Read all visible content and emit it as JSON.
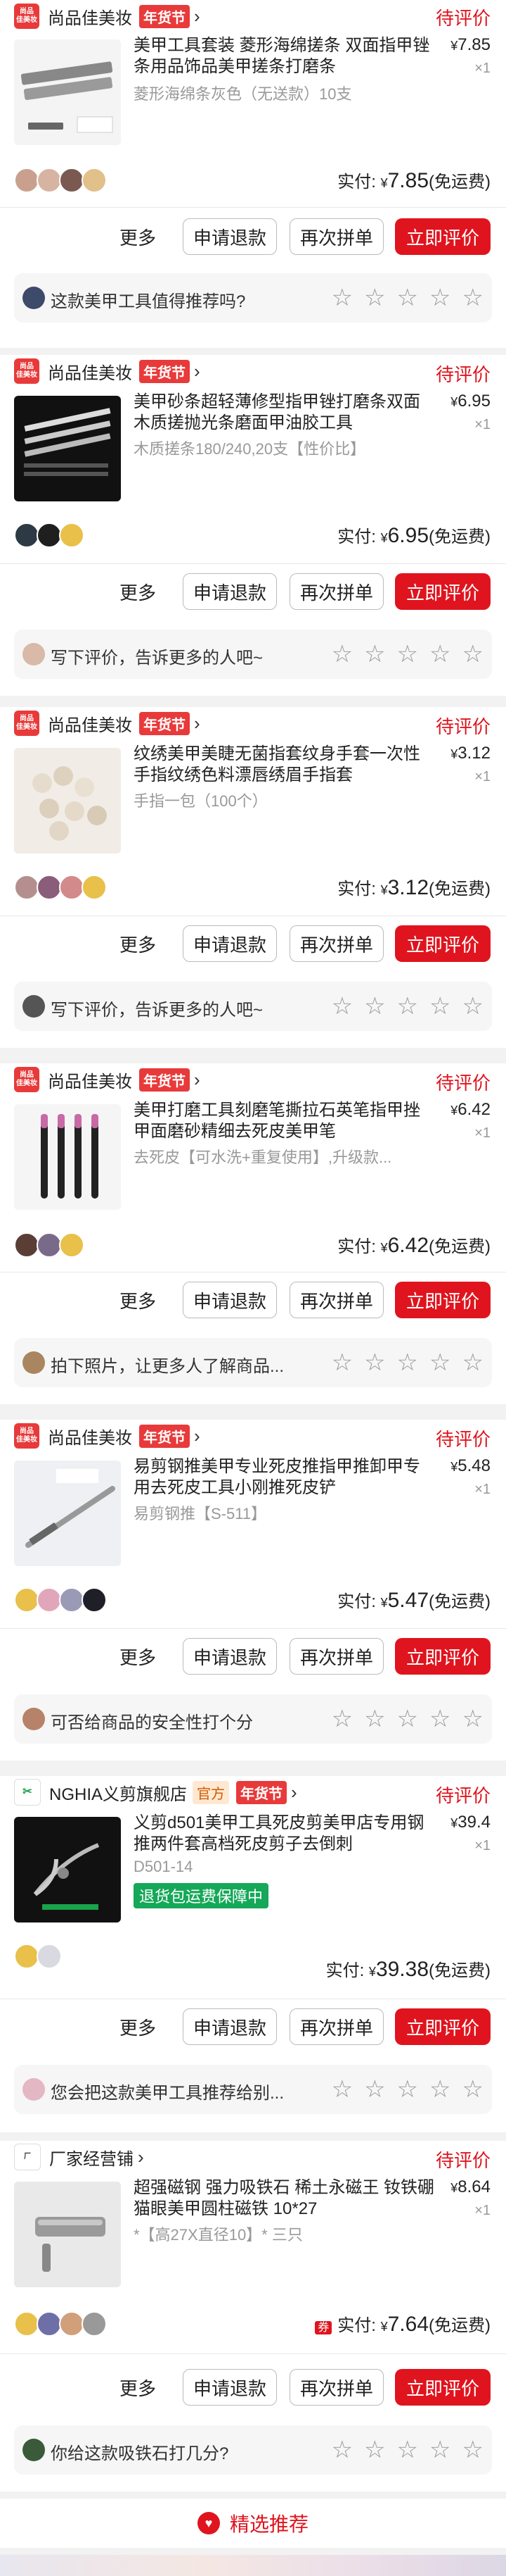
{
  "orders": [
    {
      "shop": {
        "name": "尚品佳美妆",
        "logo": "尚品\n佳美妆",
        "festival_tag": "年货节",
        "official_tag": ""
      },
      "status": "待评价",
      "product": {
        "title": "美甲工具套装 菱形海绵搓条 双面指甲锉条用品饰品美甲搓条打磨条",
        "spec": "菱形海绵条灰色（无送款）10支",
        "price": "7.85",
        "qty": "×1",
        "badge": ""
      },
      "paid": {
        "label": "实付:",
        "currency": "¥",
        "amount": "7.85",
        "note": "(免运费)"
      },
      "actions": {
        "more": "更多",
        "refund": "申请退款",
        "regroup": "再次拼单",
        "review": "立即评价"
      },
      "prompt": "这款美甲工具值得推荐吗?"
    },
    {
      "shop": {
        "name": "尚品佳美妆",
        "logo": "尚品\n佳美妆",
        "festival_tag": "年货节",
        "official_tag": ""
      },
      "status": "待评价",
      "product": {
        "title": "美甲砂条超轻薄修型指甲锉打磨条双面木质搓抛光条磨面甲油胶工具",
        "spec": "木质搓条180/240,20支【性价比】",
        "price": "6.95",
        "qty": "×1",
        "badge": ""
      },
      "paid": {
        "label": "实付:",
        "currency": "¥",
        "amount": "6.95",
        "note": "(免运费)"
      },
      "actions": {
        "more": "更多",
        "refund": "申请退款",
        "regroup": "再次拼单",
        "review": "立即评价"
      },
      "prompt": "写下评价，告诉更多的人吧~"
    },
    {
      "shop": {
        "name": "尚品佳美妆",
        "logo": "尚品\n佳美妆",
        "festival_tag": "年货节",
        "official_tag": ""
      },
      "status": "待评价",
      "product": {
        "title": "纹绣美甲美睫无菌指套纹身手套一次性手指纹绣色料漂唇绣眉手指套",
        "spec": "手指一包（100个）",
        "price": "3.12",
        "qty": "×1",
        "badge": ""
      },
      "paid": {
        "label": "实付:",
        "currency": "¥",
        "amount": "3.12",
        "note": "(免运费)"
      },
      "actions": {
        "more": "更多",
        "refund": "申请退款",
        "regroup": "再次拼单",
        "review": "立即评价"
      },
      "prompt": "写下评价，告诉更多的人吧~"
    },
    {
      "shop": {
        "name": "尚品佳美妆",
        "logo": "尚品\n佳美妆",
        "festival_tag": "年货节",
        "official_tag": ""
      },
      "status": "待评价",
      "product": {
        "title": "美甲打磨工具刻磨笔撕拉石英笔指甲挫甲面磨砂精细去死皮美甲笔",
        "spec": "去死皮【可水洗+重复使用】,升级款...",
        "price": "6.42",
        "qty": "×1",
        "badge": ""
      },
      "paid": {
        "label": "实付:",
        "currency": "¥",
        "amount": "6.42",
        "note": "(免运费)"
      },
      "actions": {
        "more": "更多",
        "refund": "申请退款",
        "regroup": "再次拼单",
        "review": "立即评价"
      },
      "prompt": "拍下照片，让更多人了解商品..."
    },
    {
      "shop": {
        "name": "尚品佳美妆",
        "logo": "尚品\n佳美妆",
        "festival_tag": "年货节",
        "official_tag": ""
      },
      "status": "待评价",
      "product": {
        "title": "易剪钢推美甲专业死皮推指甲推卸甲专用去死皮工具小刚推死皮铲",
        "spec": "易剪钢推【S-511】",
        "price": "5.48",
        "qty": "×1",
        "badge": ""
      },
      "paid": {
        "label": "实付:",
        "currency": "¥",
        "amount": "5.47",
        "note": "(免运费)"
      },
      "actions": {
        "more": "更多",
        "refund": "申请退款",
        "regroup": "再次拼单",
        "review": "立即评价"
      },
      "prompt": "可否给商品的安全性打个分"
    },
    {
      "shop": {
        "name": "NGHIA义剪旗舰店",
        "logo": "N",
        "festival_tag": "年货节",
        "official_tag": "官方"
      },
      "status": "待评价",
      "product": {
        "title": "义剪d501美甲工具死皮剪美甲店专用钢推两件套高档死皮剪子去倒刺",
        "spec": "D501-14",
        "price": "39.4",
        "qty": "×1",
        "badge": "退货包运费保障中"
      },
      "paid": {
        "label": "实付:",
        "currency": "¥",
        "amount": "39.38",
        "note": "(免运费)"
      },
      "actions": {
        "more": "更多",
        "refund": "申请退款",
        "regroup": "再次拼单",
        "review": "立即评价"
      },
      "prompt": "您会把这款美甲工具推荐给别..."
    },
    {
      "shop": {
        "name": "厂家经营铺",
        "logo": "厂",
        "festival_tag": "",
        "official_tag": ""
      },
      "status": "待评价",
      "product": {
        "title": "超强磁钢 强力吸铁石 稀土永磁王 钕铁硼 猫眼美甲圆柱磁铁 10*27",
        "spec": "*【高27X直径10】* 三只",
        "price": "8.64",
        "qty": "×1",
        "badge": ""
      },
      "paid": {
        "label": "实付:",
        "currency": "¥",
        "amount": "7.64",
        "note": "(免运费)",
        "coupon": "券"
      },
      "actions": {
        "more": "更多",
        "refund": "申请退款",
        "regroup": "再次拼单",
        "review": "立即评价"
      },
      "prompt": "你给这款吸铁石打几分?"
    }
  ],
  "recommend": {
    "label": "精选推荐",
    "icon": "heart-icon"
  },
  "colors": {
    "accent": "#e0141e",
    "status": "#e0141e",
    "badge_green": "#15a858"
  }
}
